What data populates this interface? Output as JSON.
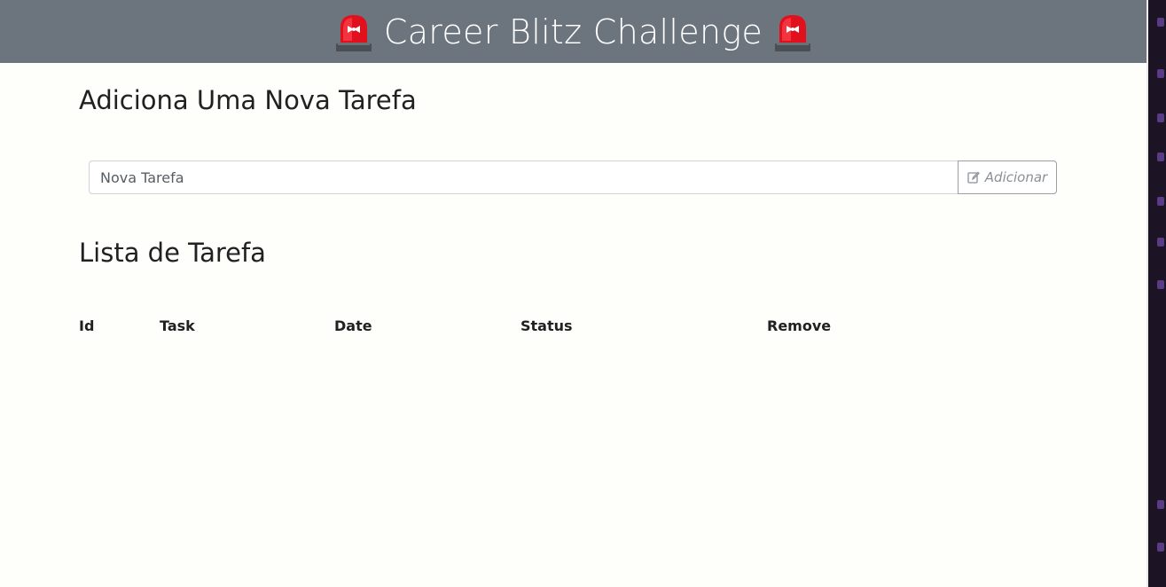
{
  "header": {
    "title": "Career Blitz Challenge",
    "icon_left": "police-siren-icon",
    "icon_right": "police-siren-icon",
    "background": "#6c757d"
  },
  "add_section": {
    "title": "Adiciona Uma Nova Tarefa",
    "input_placeholder": "Nova Tarefa",
    "input_value": "",
    "button_label": "Adicionar",
    "button_icon": "edit-icon"
  },
  "list_section": {
    "title": "Lista de Tarefa",
    "columns": [
      "Id",
      "Task",
      "Date",
      "Status",
      "Remove"
    ],
    "rows": []
  },
  "colors": {
    "page_background": "#fefefb",
    "siren_red": "#e0101c"
  }
}
